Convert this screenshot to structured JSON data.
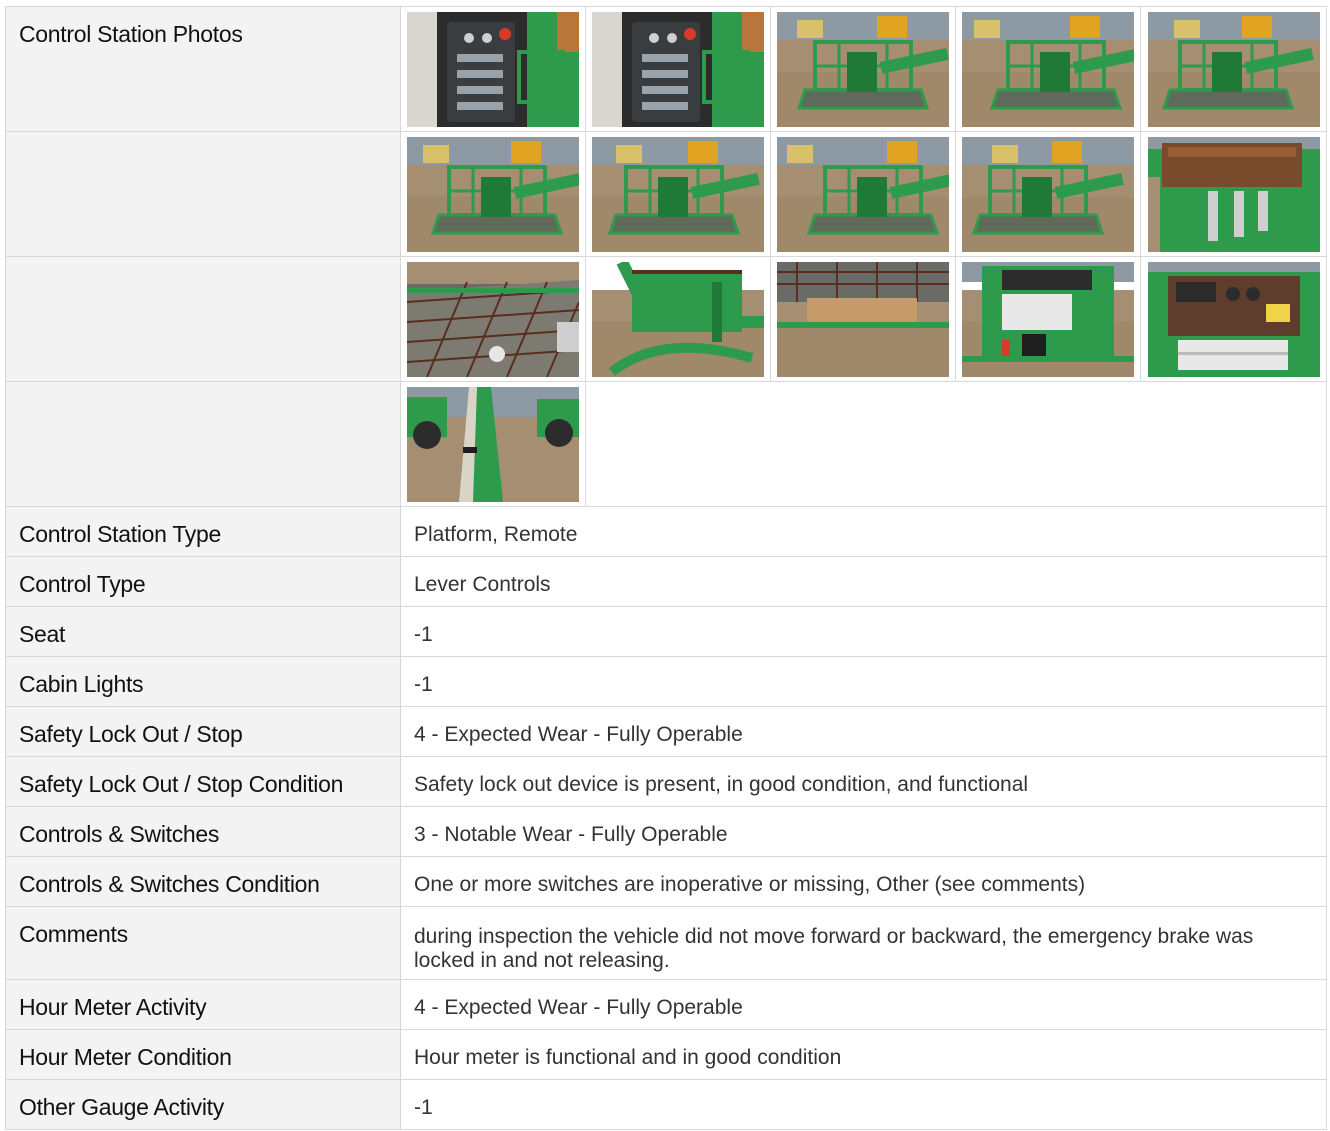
{
  "photos": {
    "label": "Control Station Photos",
    "rows": [
      [
        {
          "icon": "control-panel-photo-icon",
          "scene": "panel"
        },
        {
          "icon": "control-panel-photo-icon",
          "scene": "panel"
        },
        {
          "icon": "platform-basket-photo-icon",
          "scene": "basket-yard"
        },
        {
          "icon": "platform-basket-photo-icon",
          "scene": "basket-side"
        },
        {
          "icon": "platform-basket-photo-icon",
          "scene": "basket-boom"
        }
      ],
      [
        {
          "icon": "platform-basket-photo-icon",
          "scene": "basket-front"
        },
        {
          "icon": "platform-basket-photo-icon",
          "scene": "basket-angle"
        },
        {
          "icon": "platform-basket-photo-icon",
          "scene": "basket-rear"
        },
        {
          "icon": "platform-basket-photo-icon",
          "scene": "basket-yard2"
        },
        {
          "icon": "control-box-photo-icon",
          "scene": "rusty-box"
        }
      ],
      [
        {
          "icon": "platform-floor-photo-icon",
          "scene": "floor"
        },
        {
          "icon": "platform-rail-photo-icon",
          "scene": "rail"
        },
        {
          "icon": "platform-floor-photo-icon",
          "scene": "floor-wood"
        },
        {
          "icon": "ground-control-photo-icon",
          "scene": "ground-control"
        },
        {
          "icon": "control-panel-photo-icon",
          "scene": "panel-top"
        }
      ],
      [
        {
          "icon": "boom-photo-icon",
          "scene": "boom"
        }
      ]
    ]
  },
  "rows": [
    {
      "label": "Control Station Type",
      "value": "Platform, Remote"
    },
    {
      "label": "Control Type",
      "value": "Lever Controls"
    },
    {
      "label": "Seat",
      "value": "-1"
    },
    {
      "label": "Cabin Lights",
      "value": "-1"
    },
    {
      "label": "Safety Lock Out / Stop",
      "value": "4 - Expected Wear - Fully Operable"
    },
    {
      "label": "Safety Lock Out / Stop Condition",
      "value": "Safety lock out device is present, in good condition, and functional"
    },
    {
      "label": "Controls & Switches",
      "value": "3 - Notable Wear - Fully Operable"
    },
    {
      "label": "Controls & Switches Condition",
      "value": "One or more switches are inoperative or missing, Other (see comments)"
    },
    {
      "label": "Comments",
      "value": "during inspection the vehicle did not move forward or backward, the emergency brake was locked in and not releasing."
    },
    {
      "label": "Hour Meter Activity",
      "value": "4 - Expected Wear - Fully Operable"
    },
    {
      "label": "Hour Meter Condition",
      "value": "Hour meter is functional and in good condition"
    },
    {
      "label": "Other Gauge Activity",
      "value": "-1"
    }
  ],
  "colors": {
    "label_bg": "#f3f3f3",
    "border": "#d8d8d8",
    "equipment_green": "#2e9a4b",
    "dirt": "#a58e72"
  }
}
